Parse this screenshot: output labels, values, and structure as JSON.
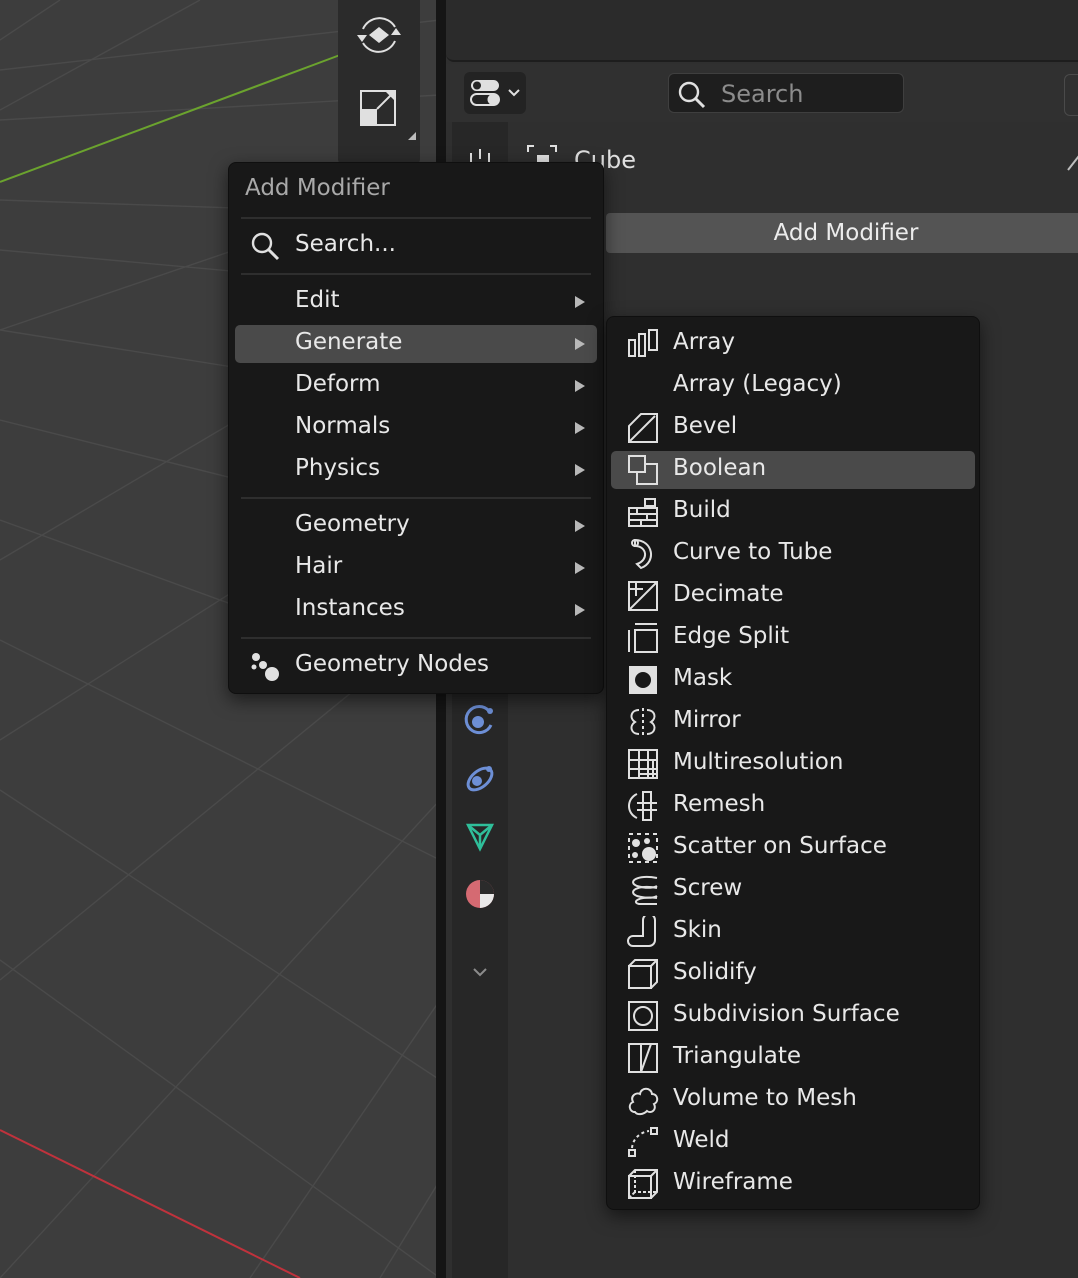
{
  "properties": {
    "search": {
      "placeholder": "Search"
    },
    "object_name": "Cube",
    "add_modifier_button": "Add Modifier"
  },
  "main_menu": {
    "title": "Add Modifier",
    "search_label": "Search...",
    "items": [
      {
        "label": "Edit",
        "submenu": true
      },
      {
        "label": "Generate",
        "submenu": true,
        "highlighted": true
      },
      {
        "label": "Deform",
        "submenu": true
      },
      {
        "label": "Normals",
        "submenu": true
      },
      {
        "label": "Physics",
        "submenu": true
      },
      {
        "label": "Geometry",
        "submenu": true
      },
      {
        "label": "Hair",
        "submenu": true
      },
      {
        "label": "Instances",
        "submenu": true
      },
      {
        "label": "Geometry Nodes",
        "icon": "geometry-nodes-icon"
      }
    ]
  },
  "generate_menu": {
    "items": [
      {
        "label": "Array",
        "icon": "array-icon"
      },
      {
        "label": "Array (Legacy)",
        "icon": ""
      },
      {
        "label": "Bevel",
        "icon": "bevel-icon"
      },
      {
        "label": "Boolean",
        "icon": "boolean-icon",
        "highlighted": true
      },
      {
        "label": "Build",
        "icon": "build-icon"
      },
      {
        "label": "Curve to Tube",
        "icon": "curve-to-tube-icon"
      },
      {
        "label": "Decimate",
        "icon": "decimate-icon"
      },
      {
        "label": "Edge Split",
        "icon": "edge-split-icon"
      },
      {
        "label": "Mask",
        "icon": "mask-icon"
      },
      {
        "label": "Mirror",
        "icon": "mirror-icon"
      },
      {
        "label": "Multiresolution",
        "icon": "multiresolution-icon"
      },
      {
        "label": "Remesh",
        "icon": "remesh-icon"
      },
      {
        "label": "Scatter on Surface",
        "icon": "scatter-icon"
      },
      {
        "label": "Screw",
        "icon": "screw-icon"
      },
      {
        "label": "Skin",
        "icon": "skin-icon"
      },
      {
        "label": "Solidify",
        "icon": "solidify-icon"
      },
      {
        "label": "Subdivision Surface",
        "icon": "subdivision-surface-icon"
      },
      {
        "label": "Triangulate",
        "icon": "triangulate-icon"
      },
      {
        "label": "Volume to Mesh",
        "icon": "volume-to-mesh-icon"
      },
      {
        "label": "Weld",
        "icon": "weld-icon"
      },
      {
        "label": "Wireframe",
        "icon": "wireframe-icon"
      }
    ]
  },
  "colors": {
    "menu_bg": "#181818",
    "highlight": "#4a4a4a",
    "viewport_bg": "#3d3d3d",
    "x_axis": "#c0323c",
    "y_axis": "#6ba32e"
  }
}
